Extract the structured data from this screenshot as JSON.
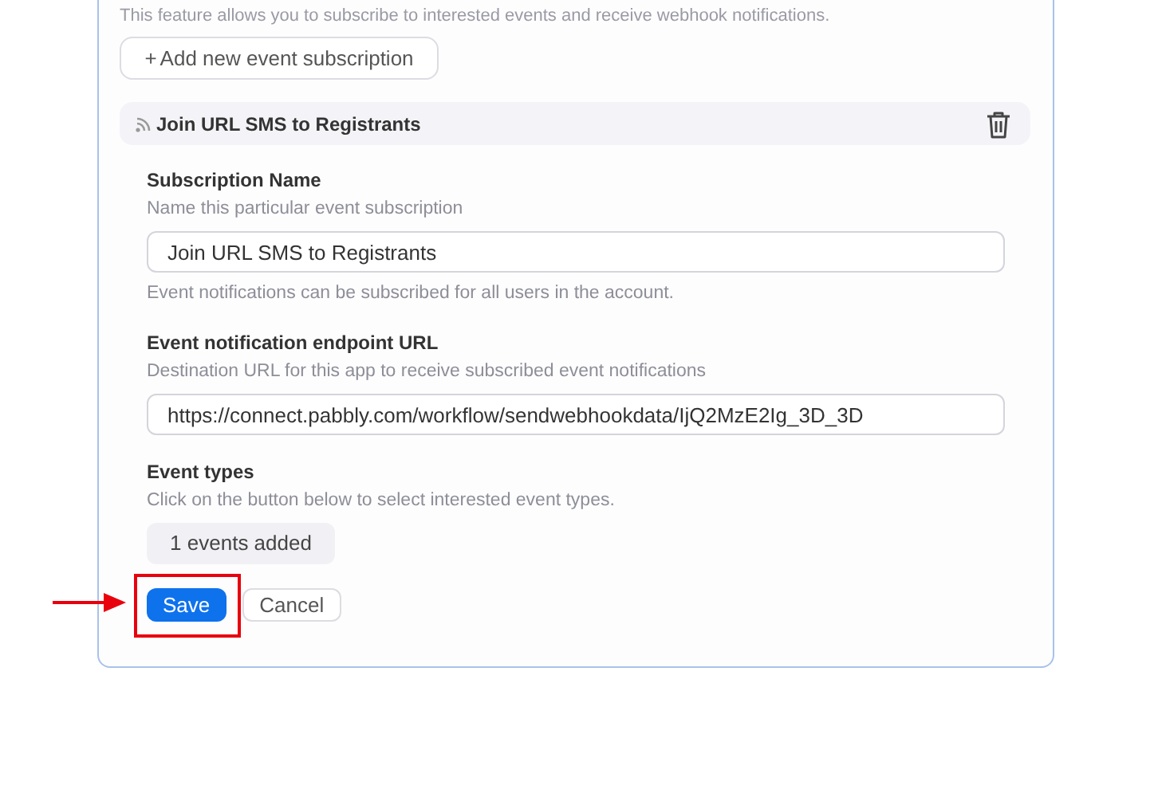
{
  "intro": "This feature allows you to subscribe to interested events and receive webhook notifications.",
  "add_button": {
    "icon": "+",
    "label": "Add new event subscription"
  },
  "subscription": {
    "title": "Join URL SMS to Registrants",
    "fields": [
      {
        "label": "Subscription Name",
        "hint": "Name this particular event subscription",
        "value": "Join URL SMS to Registrants",
        "note": "Event notifications can be subscribed for all users in the account."
      },
      {
        "label": "Event notification endpoint URL",
        "hint": "Destination URL for this app to receive subscribed event notifications",
        "value": "https://connect.pabbly.com/workflow/sendwebhookdata/IjQ2MzE2Ig_3D_3D"
      }
    ],
    "event_types": {
      "label": "Event types",
      "hint": "Click on the button below to select interested event types.",
      "button": "1 events added"
    }
  },
  "actions": [
    {
      "label": "Save",
      "kind": "primary",
      "highlighted": true
    },
    {
      "label": "Cancel",
      "kind": "secondary",
      "highlighted": false
    }
  ]
}
